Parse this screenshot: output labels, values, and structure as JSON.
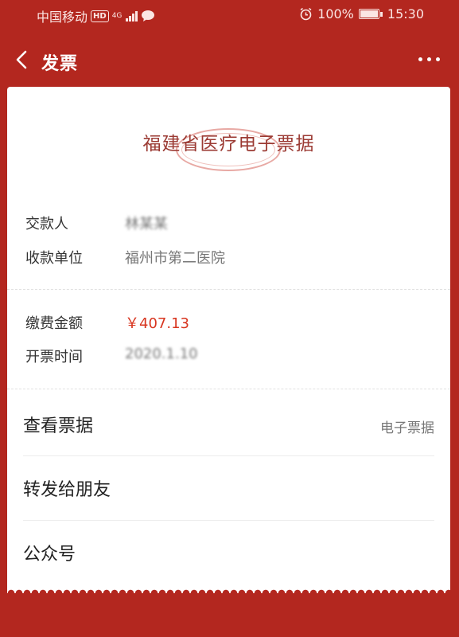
{
  "status_bar": {
    "carrier": "中国移动",
    "hd": "HD",
    "network": "4G",
    "battery": "100%",
    "time": "15:30",
    "icons": [
      "hd-icon",
      "signal-icon",
      "chat-icon",
      "alarm-icon",
      "battery-icon"
    ]
  },
  "nav": {
    "title": "发票",
    "back_icon": "chevron-left-icon",
    "more_icon": "more-dots-icon"
  },
  "receipt": {
    "title": "福建省医疗电子票据",
    "payer_label": "交款人",
    "payer_value": "林某某",
    "payee_label": "收款单位",
    "payee_value": "福州市第二医院",
    "amount_label": "缴费金额",
    "amount_value": "￥407.13",
    "time_label": "开票时间",
    "time_value": "2020.1.10"
  },
  "menu": {
    "view": {
      "label": "查看票据",
      "side": "电子票据"
    },
    "forward": {
      "label": "转发给朋友"
    },
    "official": {
      "label": "公众号"
    }
  },
  "colors": {
    "background": "#b3271f",
    "amount": "#d8351f",
    "title": "#9b3a33",
    "seal": "#e8a9a4"
  }
}
